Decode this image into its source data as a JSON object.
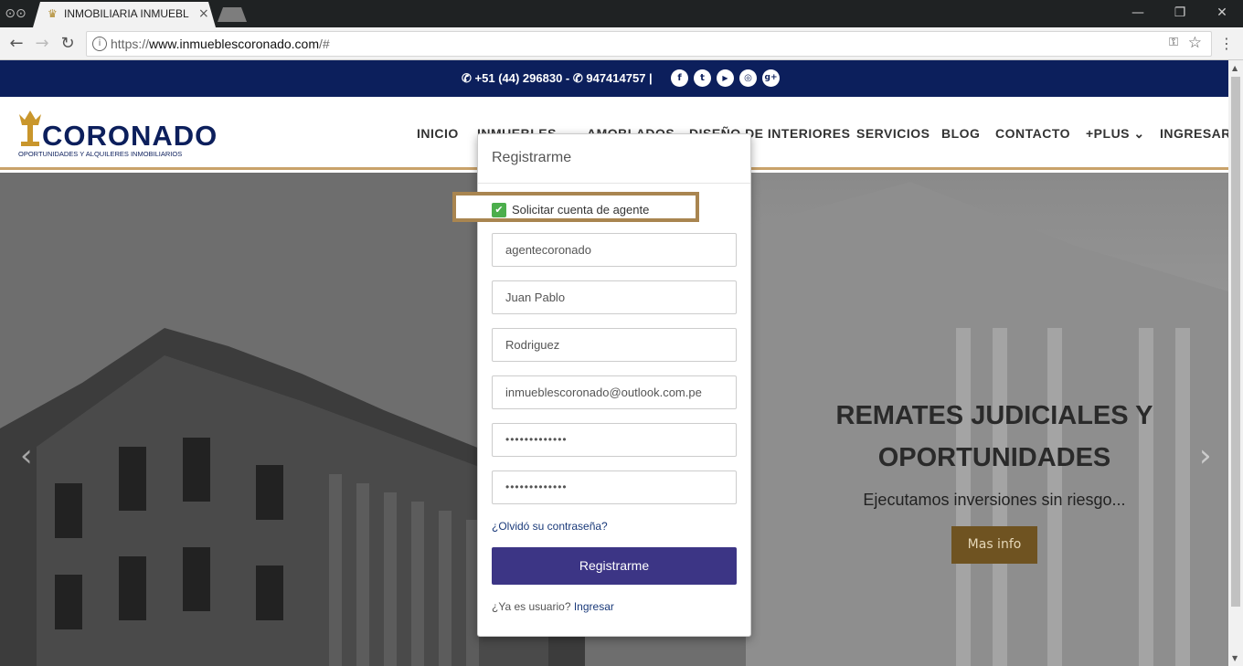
{
  "browser": {
    "tab_title": "INMOBILIARIA INMUEBL",
    "url_prefix": "https://",
    "url_domain": "www.inmueblescoronado.com",
    "url_suffix": "/#",
    "window_minimize": "—",
    "window_restore": "❐",
    "window_close": "✕",
    "back": "←",
    "forward": "→",
    "reload": "↻",
    "menu": "⋮"
  },
  "topbar": {
    "phones": "+51 (44) 296830 - ✆ 947414757 |",
    "social": [
      {
        "icon": "facebook-icon",
        "glyph": "f"
      },
      {
        "icon": "twitter-icon",
        "glyph": "t"
      },
      {
        "icon": "youtube-icon",
        "glyph": "▶"
      },
      {
        "icon": "instagram-icon",
        "glyph": "◎"
      },
      {
        "icon": "google-plus-icon",
        "glyph": "g+"
      }
    ]
  },
  "logo": {
    "name": "CORONADO",
    "tagline": "OPORTUNIDADES Y ALQUILERES INMOBILIARIOS"
  },
  "nav": {
    "items": [
      "INICIO",
      "INMUEBLES ⌄",
      "AMOBLADOS",
      "DISEÑO DE INTERIORES",
      "SERVICIOS",
      "BLOG",
      "CONTACTO",
      "+PLUS ⌄",
      "INGRESAR"
    ]
  },
  "hero": {
    "title_line1": "REMATES JUDICIALES Y",
    "title_line2": "OPORTUNIDADES",
    "subtitle": "Ejecutamos inversiones sin riesgo...",
    "button": "Mas info",
    "prev": "‹",
    "next": "›"
  },
  "register": {
    "title": "Registrarme",
    "agent_checkbox_label": "Solicitar cuenta de agente",
    "agent_checked": true,
    "username": "agentecoronado",
    "first_name": "Juan Pablo",
    "last_name": "Rodriguez",
    "email": "inmueblescoronado@outlook.com.pe",
    "password": "•••••••••••••",
    "password_confirm": "•••••••••••••",
    "forgot": "¿Olvidó su contraseña?",
    "submit": "Registrarme",
    "already_text": "¿Ya es usuario?",
    "login_link": "Ingresar"
  },
  "colors": {
    "navy": "#0c1f5c",
    "gold": "#a98550",
    "button": "#3c3585",
    "check": "#4cae4c"
  }
}
